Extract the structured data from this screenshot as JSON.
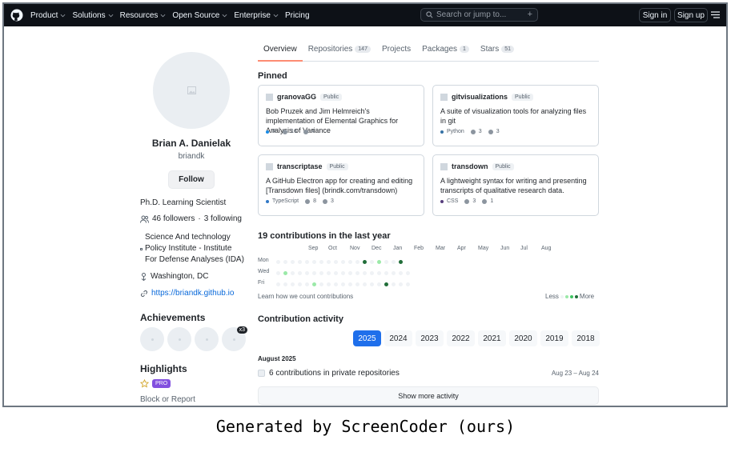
{
  "nav": {
    "items": [
      "Product",
      "Solutions",
      "Resources",
      "Open Source",
      "Enterprise",
      "Pricing"
    ],
    "search_placeholder": "Search or jump to...",
    "sign_in": "Sign in",
    "sign_up": "Sign up"
  },
  "profile": {
    "name": "Brian A. Danielak",
    "username": "briandk",
    "follow_label": "Follow",
    "bio": "Ph.D. Learning Scientist",
    "followers": "46 followers",
    "following": "3 following",
    "org": [
      "Science And technology",
      "Policy Institute - Institute",
      "For Defense Analyses (IDA)"
    ],
    "location": "Washington, DC",
    "website": "https://briandk.github.io",
    "achievements_title": "Achievements",
    "achievement_multiplier": "x3",
    "highlights_title": "Highlights",
    "pro_label": "PRO",
    "block_label": "Block or Report"
  },
  "tabs": [
    {
      "label": "Overview",
      "count": ""
    },
    {
      "label": "Repositories",
      "count": "147"
    },
    {
      "label": "Projects",
      "count": ""
    },
    {
      "label": "Packages",
      "count": "1"
    },
    {
      "label": "Stars",
      "count": "51"
    }
  ],
  "pinned": {
    "title": "Pinned",
    "repos": [
      {
        "name": "granovaGG",
        "visibility": "Public",
        "desc": "Bob Pruzek and Jim Helmreich's implementation of Elemental Graphics for Analysis of Variance",
        "lang": "R",
        "lang_color": "#198ce7",
        "stars": "16",
        "forks": "4"
      },
      {
        "name": "gitvisualizations",
        "visibility": "Public",
        "desc": "A suite of visualization tools for analyzing files in git",
        "lang": "Python",
        "lang_color": "#3572a5",
        "stars": "3",
        "forks": "3"
      },
      {
        "name": "transcriptase",
        "visibility": "Public",
        "desc": "A GitHub Electron app for creating and editing [Transdown files] (brindk.com/transdown)",
        "lang": "TypeScript",
        "lang_color": "#3178c6",
        "stars": "8",
        "forks": "3"
      },
      {
        "name": "transdown",
        "visibility": "Public",
        "desc": "A lightweight syntax for writing and presenting transcripts of qualitative research data.",
        "lang": "CSS",
        "lang_color": "#563d7c",
        "stars": "3",
        "forks": "1"
      }
    ]
  },
  "contributions": {
    "title": "19 contributions in the last year",
    "months": [
      "Sep",
      "Oct",
      "Nov",
      "Dec",
      "Jan",
      "Feb",
      "Mar",
      "Apr",
      "May",
      "Jun",
      "Jul",
      "Aug"
    ],
    "days": [
      "Mon",
      "Wed",
      "Fri"
    ],
    "learn": "Learn how we count contributions",
    "less": "Less",
    "more": "More"
  },
  "activity": {
    "title": "Contribution activity",
    "years": [
      "2025",
      "2024",
      "2023",
      "2022",
      "2021",
      "2020",
      "2019",
      "2018"
    ],
    "active_year": "2025",
    "month_heading": "August 2025",
    "item_text": "6 contributions in private repositories",
    "item_date": "Aug 23 – Aug 24",
    "show_more": "Show more activity"
  },
  "caption": "Generated by ScreenCoder (ours)"
}
